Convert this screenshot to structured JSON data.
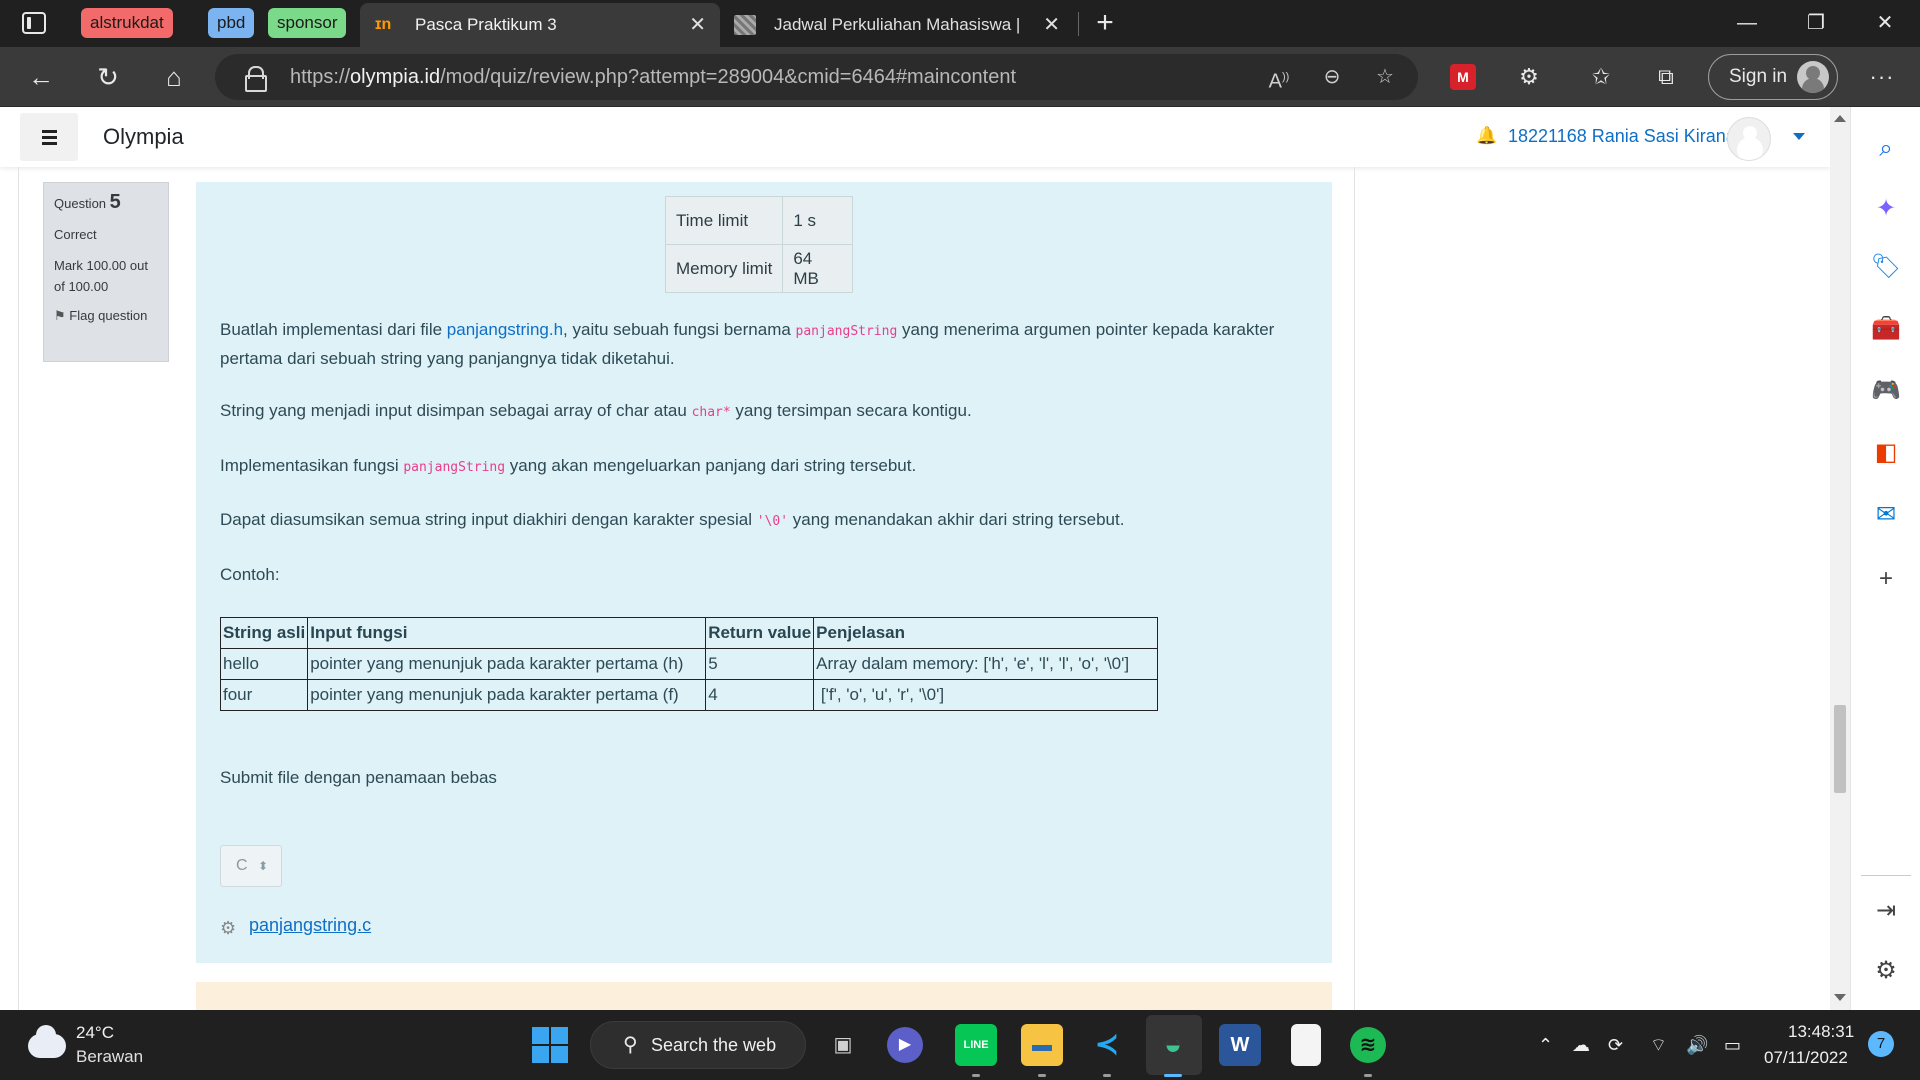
{
  "browser": {
    "tab_groups": [
      "alstrukdat",
      "pbd",
      "sponsor"
    ],
    "tabs": [
      {
        "title": "Pasca Praktikum 3",
        "active": true
      },
      {
        "title": "Jadwal Perkuliahan Mahasiswa | S",
        "active": false
      }
    ],
    "url": {
      "scheme": "https://",
      "host": "olympia.id",
      "path": "/mod/quiz/review.php?attempt=289004&cmid=6464#maincontent"
    },
    "sign_in_label": "Sign in"
  },
  "site": {
    "name": "Olympia",
    "user_name": "18221168 Rania Sasi Kirana"
  },
  "question_info": {
    "label": "Question",
    "number": "5",
    "status": "Correct",
    "mark": "Mark 100.00 out of 100.00",
    "flag_label": "Flag question"
  },
  "question": {
    "limits": [
      {
        "label": "Time limit",
        "value": "1 s"
      },
      {
        "label": "Memory limit",
        "value": "64 MB"
      }
    ],
    "p1_before": "Buatlah implementasi dari file ",
    "p1_link": "panjangstring.h",
    "p1_mid": ", yaitu sebuah fungsi bernama ",
    "p1_code": "panjangString",
    "p1_after": " yang menerima argumen pointer kepada karakter pertama dari sebuah string yang panjangnya tidak diketahui.",
    "p2_before": "String yang menjadi input disimpan sebagai array of char atau ",
    "p2_code": "char*",
    "p2_after": " yang tersimpan secara kontigu.",
    "p3_before": "Implementasikan fungsi ",
    "p3_code": "panjangString",
    "p3_after": " yang akan mengeluarkan panjang dari string tersebut.",
    "p4_before": "Dapat diasumsikan semua string input diakhiri dengan karakter spesial ",
    "p4_code": "'\\0'",
    "p4_after": " yang menandakan akhir dari string tersebut.",
    "example_label": "Contoh:",
    "table_headers": [
      "String asli",
      "Input fungsi",
      "Return value",
      "Penjelasan"
    ],
    "table_rows": [
      [
        "hello",
        "pointer yang menunjuk pada karakter pertama (h)",
        "5",
        "Array dalam memory: ['h', 'e', 'l', 'l', 'o', '\\0']"
      ],
      [
        "four",
        "pointer yang menunjuk pada karakter pertama (f)",
        "4",
        " ['f', 'o', 'u', 'r', '\\0']"
      ]
    ],
    "submit_note": "Submit file dengan penamaan bebas",
    "language_value": "C",
    "submitted_file": "panjangstring.c"
  },
  "taskbar": {
    "temperature": "24°C",
    "weather": "Berawan",
    "search_label": "Search the web",
    "time": "13:48:31",
    "date": "07/11/2022",
    "notification_count": "7"
  },
  "colors": {
    "question_bg": "#def2f8",
    "link": "#0f6fc5",
    "code": "#e83e8c",
    "next_panel_bg": "#fcefdc"
  }
}
